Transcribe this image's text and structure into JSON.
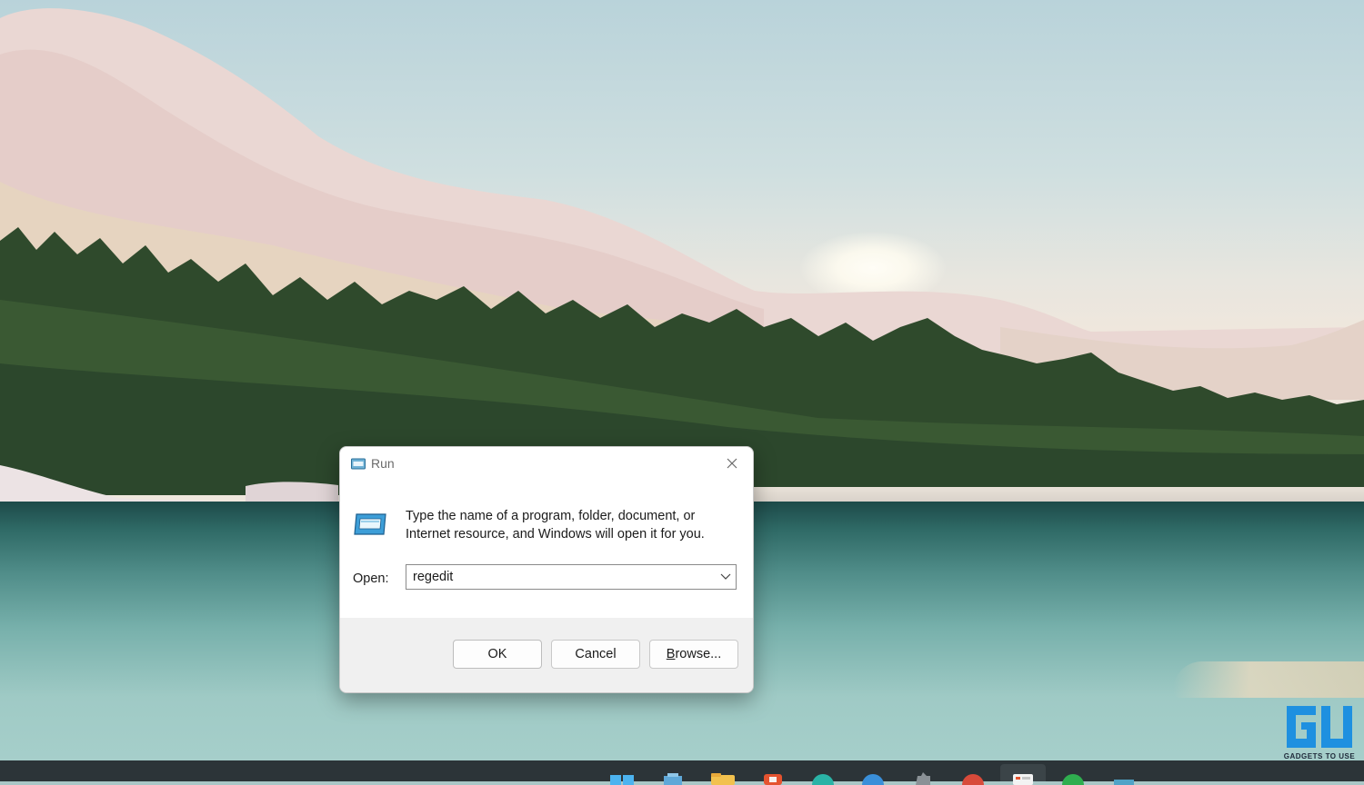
{
  "dialog": {
    "title": "Run",
    "description": "Type the name of a program, folder, document, or Internet resource, and Windows will open it for you.",
    "open_label": "Open:",
    "open_value": "regedit",
    "ok_label": "OK",
    "cancel_label": "Cancel",
    "browse_label": "Browse..."
  },
  "watermark": {
    "text": "GADGETS TO USE"
  },
  "taskbar": {
    "items": [
      "start-icon",
      "widgets-icon",
      "file-explorer-icon",
      "office-icon",
      "edge-icon",
      "chrome-icon",
      "settings-icon",
      "app-icon",
      "run-icon",
      "spotify-icon",
      "terminal-icon"
    ]
  },
  "colors": {
    "dialog_footer": "#f0f0f0",
    "taskbar": "#2c3438",
    "accent": "#1a8fd6"
  }
}
